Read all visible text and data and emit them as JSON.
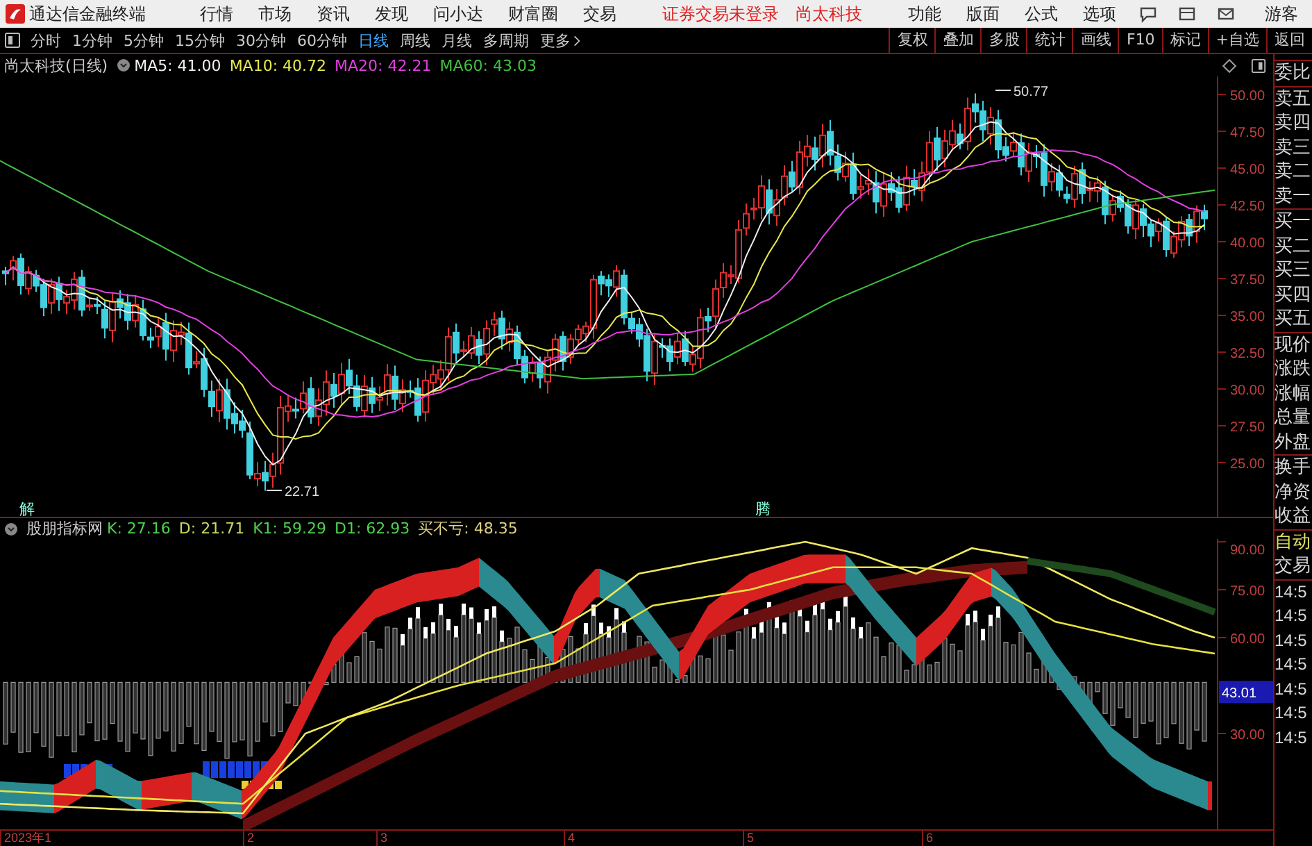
{
  "app": {
    "title": "通达信金融终端",
    "menu": [
      "行情",
      "市场",
      "资讯",
      "发现",
      "问小达",
      "财富圈",
      "交易"
    ],
    "status": [
      "证券交易未登录",
      "尚太科技"
    ],
    "right_menu": [
      "功能",
      "版面",
      "公式",
      "选项"
    ],
    "user": "游客"
  },
  "toolbar": {
    "periods": [
      {
        "label": "分时",
        "selected": false
      },
      {
        "label": "1分钟",
        "selected": false
      },
      {
        "label": "5分钟",
        "selected": false
      },
      {
        "label": "15分钟",
        "selected": false
      },
      {
        "label": "30分钟",
        "selected": false
      },
      {
        "label": "60分钟",
        "selected": false
      },
      {
        "label": "日线",
        "selected": true
      },
      {
        "label": "周线",
        "selected": false
      },
      {
        "label": "月线",
        "selected": false
      },
      {
        "label": "多周期",
        "selected": false
      }
    ],
    "more": "更多",
    "actions": [
      "复权",
      "叠加",
      "多股",
      "统计",
      "画线",
      "F10",
      "标记",
      "+自选",
      "返回"
    ]
  },
  "price_chart": {
    "title": "尚太科技(日线)",
    "indicators": [
      {
        "label": "MA5: 41.00",
        "color": "#f0f0f0"
      },
      {
        "label": "MA10: 40.72",
        "color": "#e8e850"
      },
      {
        "label": "MA20: 42.21",
        "color": "#e040e0"
      },
      {
        "label": "MA60: 43.03",
        "color": "#40c040"
      }
    ],
    "y_ticks": [
      "50.00",
      "47.50",
      "45.00",
      "42.50",
      "40.00",
      "37.50",
      "35.00",
      "32.50",
      "30.00",
      "27.50",
      "25.00"
    ],
    "high_label": "50.77",
    "low_label": "22.71",
    "markers": [
      "解",
      "腾"
    ]
  },
  "indicator_chart": {
    "title": "股朋指标网",
    "values": [
      {
        "label": "K: 27.16",
        "color": "#50d050"
      },
      {
        "label": "D: 21.71",
        "color": "#c8d860"
      },
      {
        "label": "K1: 59.29",
        "color": "#50d050"
      },
      {
        "label": "D1: 62.93",
        "color": "#50d050"
      },
      {
        "label": "买不亏: 48.35",
        "color": "#e0d080"
      }
    ],
    "y_ticks": [
      "90.00",
      "75.00",
      "60.00",
      "30.00"
    ],
    "current_value": "43.01"
  },
  "x_axis": [
    "2023年1",
    "2",
    "3",
    "4",
    "5",
    "6"
  ],
  "quote_panel": {
    "groups": [
      [
        "委比"
      ],
      [
        "卖五",
        "卖四",
        "卖三",
        "卖二",
        "卖一"
      ],
      [
        "买一",
        "买二",
        "买三",
        "买四",
        "买五"
      ],
      [
        "现价",
        "涨跌",
        "涨幅",
        "总量",
        "外盘"
      ],
      [
        "换手",
        "净资",
        "收益"
      ]
    ],
    "mode": "自动",
    "trade_header": "交易",
    "trades": [
      "14:5",
      "14:5",
      "14:5",
      "14:5",
      "14:5",
      "14:5",
      "14:5"
    ]
  }
}
